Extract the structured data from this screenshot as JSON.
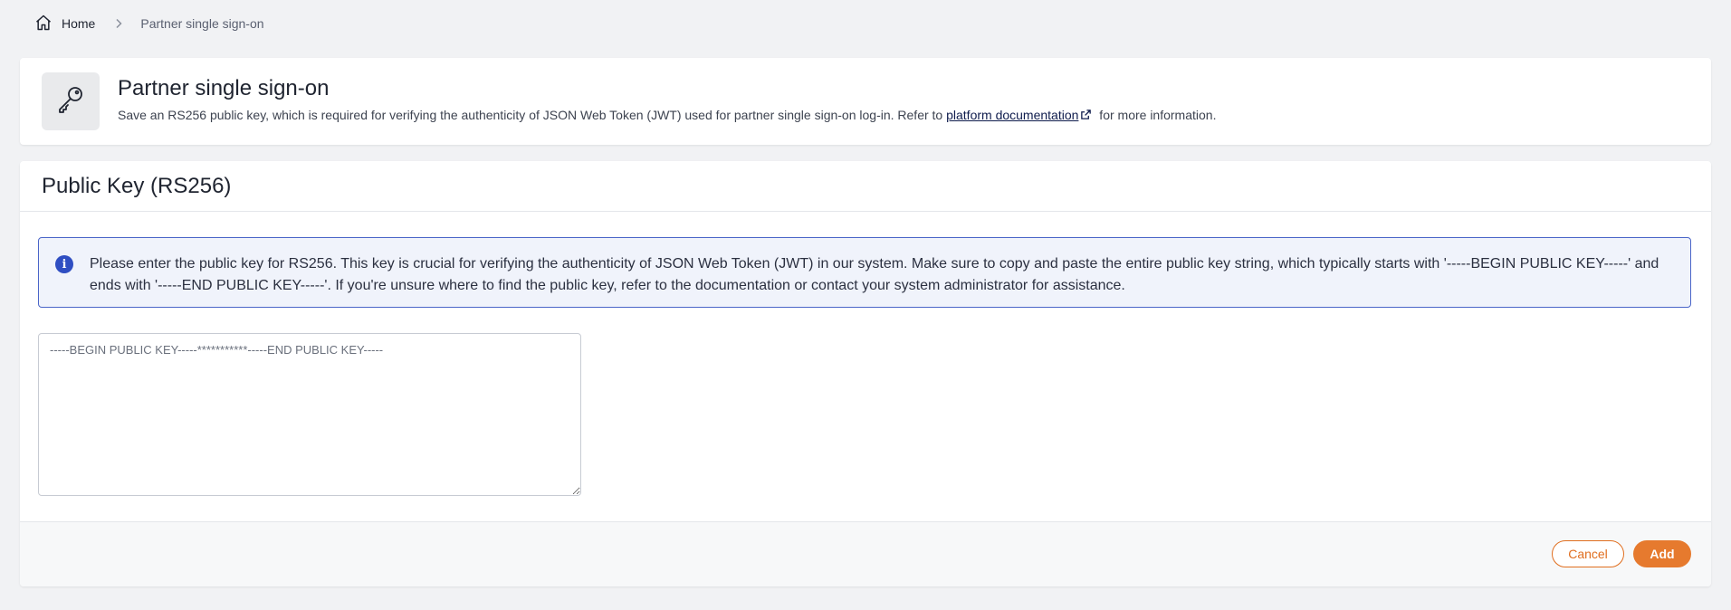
{
  "breadcrumb": {
    "home_label": "Home",
    "current_label": "Partner single sign-on"
  },
  "header": {
    "icon": "key-icon",
    "title": "Partner single sign-on",
    "description_before": "Save an RS256 public key, which is required for verifying the authenticity of JSON Web Token (JWT) used for partner single sign-on log-in. Refer to ",
    "link_text": "platform documentation",
    "description_after": " for more information."
  },
  "section": {
    "title": "Public Key (RS256)",
    "info_icon": "info-icon",
    "info_text": "Please enter the public key for RS256. This key is crucial for verifying the authenticity of JSON Web Token (JWT) in our system. Make sure to copy and paste the entire public key string, which typically starts with '-----BEGIN PUBLIC KEY-----' and ends with '-----END PUBLIC KEY-----'. If you're unsure where to find the public key, refer to the documentation or contact your system administrator for assistance.",
    "textarea_value": "",
    "textarea_placeholder": "-----BEGIN PUBLIC KEY-----***********-----END PUBLIC KEY-----"
  },
  "footer": {
    "cancel_label": "Cancel",
    "add_label": "Add"
  },
  "colors": {
    "accent": "#e67a2e",
    "info_border": "#4a65c8",
    "info_bg": "#f0f3fb",
    "link": "#0f1c4d"
  }
}
